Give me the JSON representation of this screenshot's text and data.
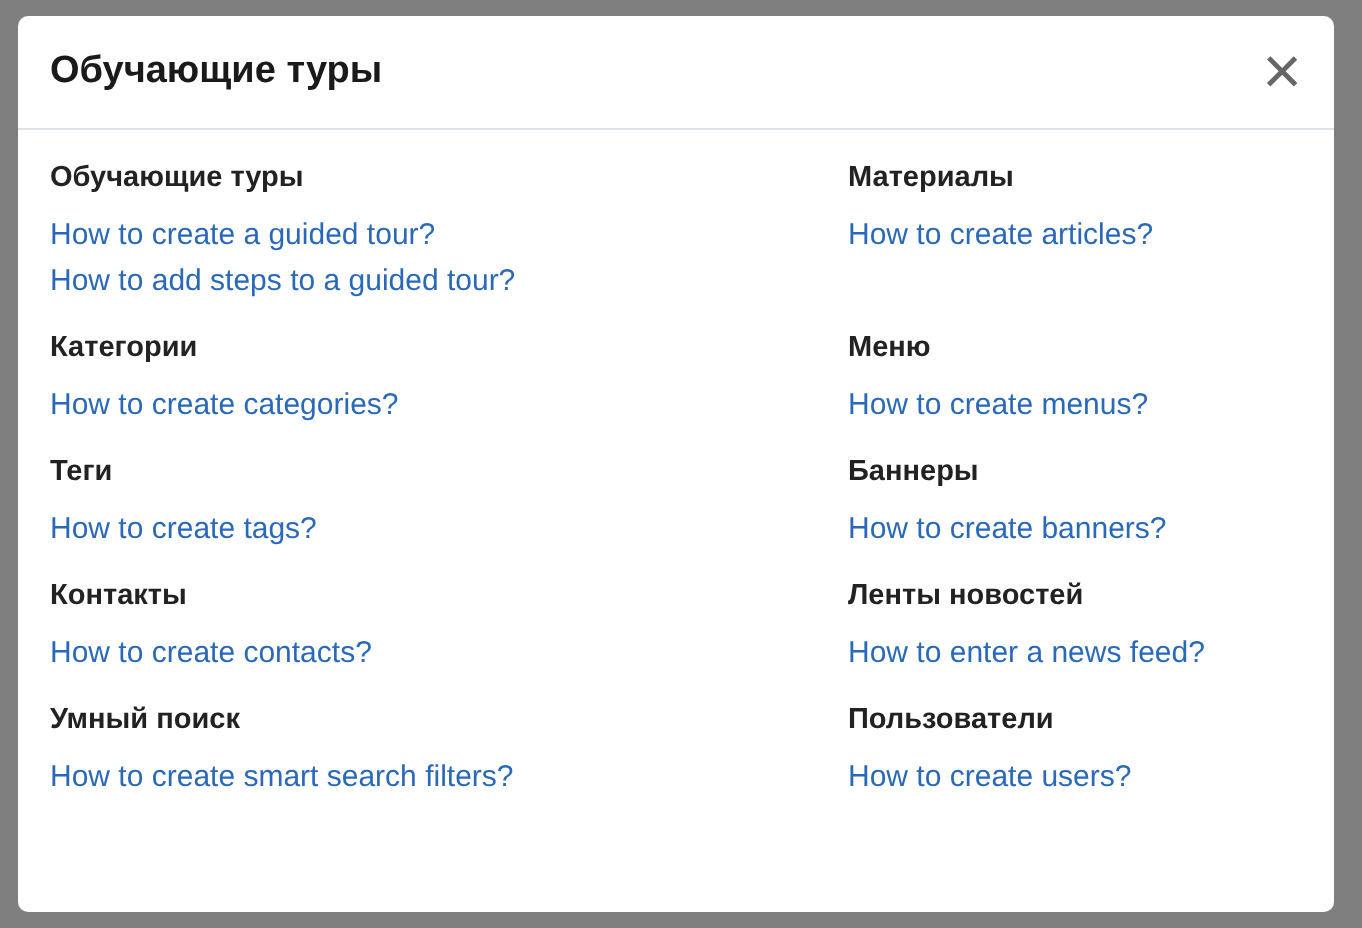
{
  "dialog": {
    "title": "Обучающие туры",
    "close": "×"
  },
  "sections": [
    {
      "heading": "Обучающие туры",
      "links": [
        "How to create a guided tour?",
        "How to add steps to a guided tour?"
      ]
    },
    {
      "heading": "Материалы",
      "links": [
        "How to create articles?"
      ]
    },
    {
      "heading": "Категории",
      "links": [
        "How to create categories?"
      ]
    },
    {
      "heading": "Меню",
      "links": [
        "How to create menus?"
      ]
    },
    {
      "heading": "Теги",
      "links": [
        "How to create tags?"
      ]
    },
    {
      "heading": "Баннеры",
      "links": [
        "How to create banners?"
      ]
    },
    {
      "heading": "Контакты",
      "links": [
        "How to create contacts?"
      ]
    },
    {
      "heading": "Ленты новостей",
      "links": [
        "How to enter a news feed?"
      ]
    },
    {
      "heading": "Умный поиск",
      "links": [
        "How to create smart search filters?"
      ]
    },
    {
      "heading": "Пользователи",
      "links": [
        "How to create users?"
      ]
    }
  ]
}
